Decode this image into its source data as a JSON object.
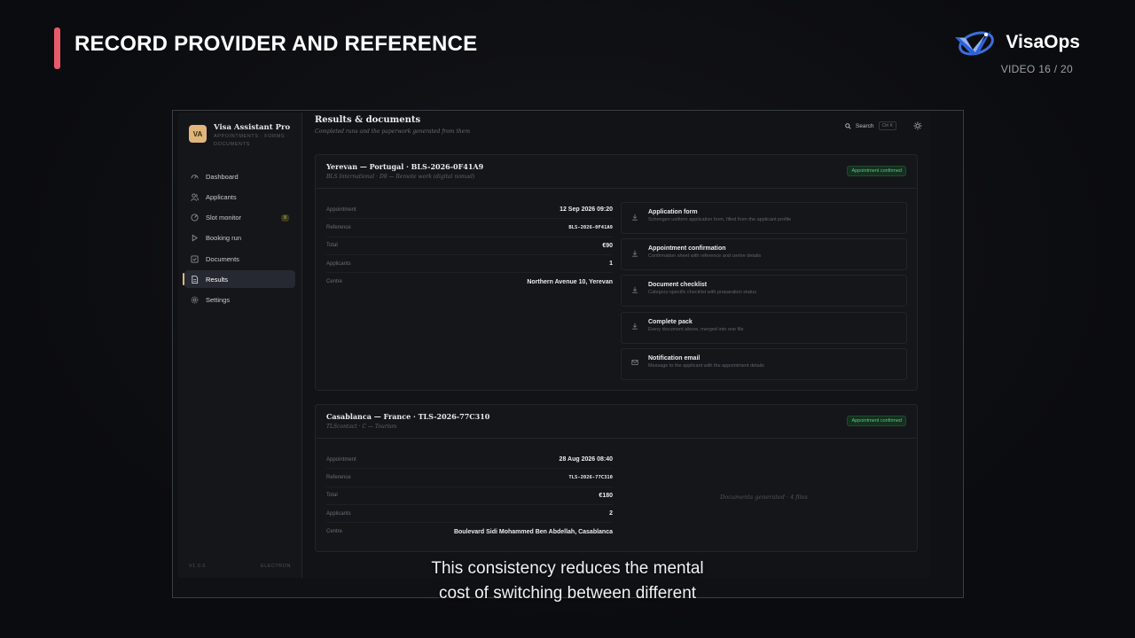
{
  "overlay": {
    "title": "RECORD PROVIDER AND REFERENCE",
    "brand": "VisaOps",
    "counter": "VIDEO 16 / 20",
    "caption_line1": "This consistency reduces the mental",
    "caption_line2": "cost of switching between different"
  },
  "sidebar": {
    "avatar": "VA",
    "app_name": "Visa Assistant Pro",
    "app_sub_line1": "APPOINTMENTS · FORMS ·",
    "app_sub_line2": "DOCUMENTS",
    "items": [
      {
        "label": "Dashboard",
        "icon": "gauge-icon"
      },
      {
        "label": "Applicants",
        "icon": "users-icon"
      },
      {
        "label": "Slot monitor",
        "icon": "radar-icon",
        "badge": "8"
      },
      {
        "label": "Booking run",
        "icon": "play-icon"
      },
      {
        "label": "Documents",
        "icon": "checkbox-icon"
      },
      {
        "label": "Results",
        "icon": "file-icon",
        "active": true
      },
      {
        "label": "Settings",
        "icon": "gear-icon"
      }
    ],
    "version": "V1.0.0",
    "platform": "ELECTRON"
  },
  "topbar": {
    "title": "Results & documents",
    "subtitle": "Completed runs and the paperwork generated from them",
    "search_label": "Search",
    "search_shortcut": "Ctrl K"
  },
  "results": [
    {
      "title": "Yerevan — Portugal · BLS-2026-0F41A9",
      "subtitle": "BLS International · D8 — Remote work (digital nomad)",
      "status": "Appointment confirmed",
      "details": [
        {
          "key": "Appointment",
          "value": "12 Sep 2026 09:20"
        },
        {
          "key": "Reference",
          "value": "BLS-2026-0F41A9"
        },
        {
          "key": "Total",
          "value": "€90"
        },
        {
          "key": "Applicants",
          "value": "1"
        },
        {
          "key": "Centre",
          "value": "Northern Avenue 10, Yerevan"
        }
      ],
      "documents": [
        {
          "title": "Application form",
          "desc": "Schengen uniform application form, filled from the applicant profile",
          "icon": "download-icon"
        },
        {
          "title": "Appointment confirmation",
          "desc": "Confirmation sheet with reference and centre details",
          "icon": "download-icon"
        },
        {
          "title": "Document checklist",
          "desc": "Category-specific checklist with preparation status",
          "icon": "download-icon"
        },
        {
          "title": "Complete pack",
          "desc": "Every document above, merged into one file",
          "icon": "download-icon"
        },
        {
          "title": "Notification email",
          "desc": "Message to the applicant with the appointment details",
          "icon": "mail-icon"
        }
      ]
    },
    {
      "title": "Casablanca — France · TLS-2026-77C310",
      "subtitle": "TLScontact · C — Tourism",
      "status": "Appointment confirmed",
      "details": [
        {
          "key": "Appointment",
          "value": "28 Aug 2026 08:40"
        },
        {
          "key": "Reference",
          "value": "TLS-2026-77C310"
        },
        {
          "key": "Total",
          "value": "€180"
        },
        {
          "key": "Applicants",
          "value": "2"
        },
        {
          "key": "Centre",
          "value": "Boulevard Sidi Mohammed Ben Abdellah, Casablanca"
        }
      ],
      "documents_note": "Documents generated · 4 files"
    }
  ]
}
